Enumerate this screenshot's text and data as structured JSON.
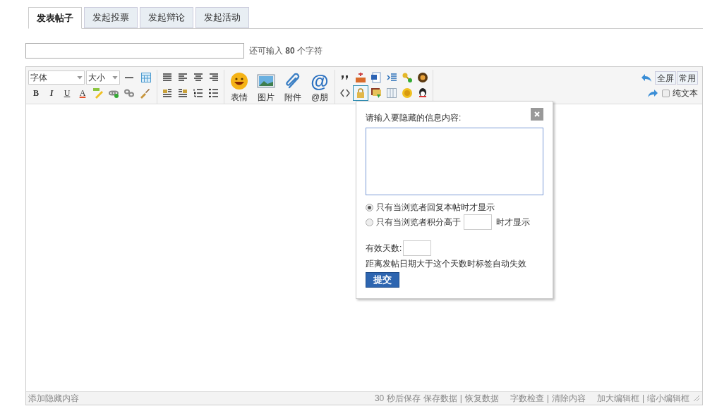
{
  "tabs": [
    {
      "label": "发表帖子",
      "selected": true
    },
    {
      "label": "发起投票",
      "selected": false
    },
    {
      "label": "发起辩论",
      "selected": false
    },
    {
      "label": "发起活动",
      "selected": false
    }
  ],
  "title_field": {
    "counter": "还可输入 **80** 个字符"
  },
  "toolbar": {
    "font_select": "字体",
    "size_select": "大小",
    "format_buttons": [
      "B",
      "I",
      "U",
      "A"
    ],
    "big_buttons": [
      {
        "kind": "smiley",
        "label": "表情"
      },
      {
        "kind": "image",
        "label": "图片"
      },
      {
        "kind": "attach",
        "label": "附件"
      },
      {
        "kind": "at",
        "glyph": "@",
        "label": "@朋"
      }
    ],
    "hide_button_active": true,
    "view_buttons": [
      "全屏",
      "常用"
    ],
    "plain_text": {
      "label": "纯文本",
      "checked": false
    }
  },
  "hide_popup": {
    "prompt": "请输入要隐藏的信息内容:",
    "options": [
      {
        "kind": "reply",
        "label": "只有当浏览者回复本帖时才显示",
        "selected": true
      },
      {
        "kind": "score",
        "label": "只有当浏览者积分高于",
        "suffix": "时才显示",
        "selected": false
      }
    ],
    "days_label": "有效天数:",
    "days_hint": "距离发帖日期大于这个天数时标签自动失效",
    "submit": "提交"
  },
  "status_bar": {
    "left": "添加隐藏内容",
    "autosave": "30 秒后保存",
    "separator": "|",
    "link_groups": [
      [
        "保存数据",
        "恢复数据"
      ],
      [
        "字数检查",
        "清除内容"
      ],
      [
        "加大编辑框",
        "缩小编辑框"
      ]
    ]
  }
}
